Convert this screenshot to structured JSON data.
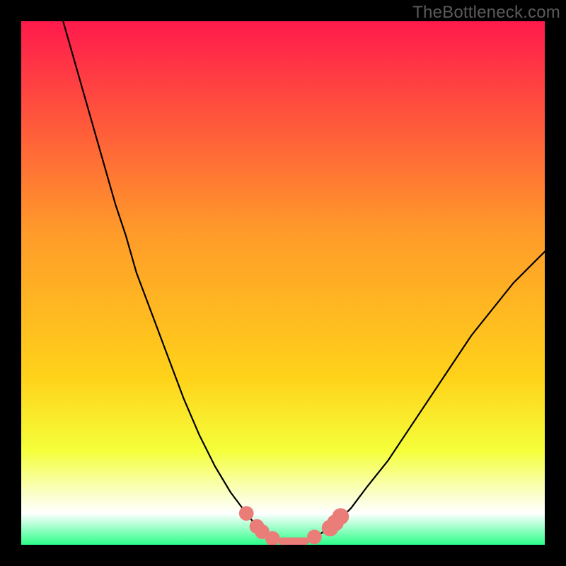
{
  "watermark": "TheBottleneck.com",
  "palette": {
    "frame_bg": "#000000",
    "grad_top": "#ff1a4c",
    "grad_mid1": "#ff6a2a",
    "grad_mid2": "#ffd21a",
    "grad_lemon": "#f5ff3a",
    "grad_pale": "#faffc4",
    "grad_whiteish": "#ffffff",
    "grad_green": "#2cff88",
    "curve_color": "#000000",
    "marker_color": "#eb7d78"
  },
  "chart_data": {
    "type": "line",
    "title": "",
    "xlabel": "",
    "ylabel": "",
    "xlim": [
      0,
      100
    ],
    "ylim": [
      0,
      100
    ],
    "series": [
      {
        "name": "bottleneck-curve",
        "x": [
          8,
          10,
          12,
          14,
          16,
          18,
          20,
          22,
          25,
          28,
          31,
          34,
          37,
          40,
          43,
          45,
          47,
          49,
          51,
          53,
          55,
          57,
          60,
          63,
          66,
          70,
          74,
          78,
          82,
          86,
          90,
          94,
          98,
          100
        ],
        "y": [
          100,
          93,
          86,
          79,
          72,
          65,
          59,
          52,
          44,
          36,
          28,
          21,
          15,
          10,
          6,
          3.5,
          2,
          1,
          0.5,
          0.5,
          1,
          2,
          4,
          7,
          11,
          16,
          22,
          28,
          34,
          40,
          45,
          50,
          54,
          56
        ]
      }
    ],
    "markers": [
      {
        "x": 43,
        "y": 6,
        "r": 1.4
      },
      {
        "x": 45,
        "y": 3.5,
        "r": 1.4
      },
      {
        "x": 46,
        "y": 2.5,
        "r": 1.4
      },
      {
        "x": 48,
        "y": 1.2,
        "r": 1.4
      },
      {
        "x": 56,
        "y": 1.5,
        "r": 1.4
      },
      {
        "x": 59,
        "y": 3.2,
        "r": 1.6
      },
      {
        "x": 60,
        "y": 4.2,
        "r": 1.6
      },
      {
        "x": 61,
        "y": 5.4,
        "r": 1.6
      }
    ],
    "trough_bar": {
      "x_start": 49,
      "x_end": 55,
      "y": 0.7,
      "thickness": 1.4
    }
  }
}
